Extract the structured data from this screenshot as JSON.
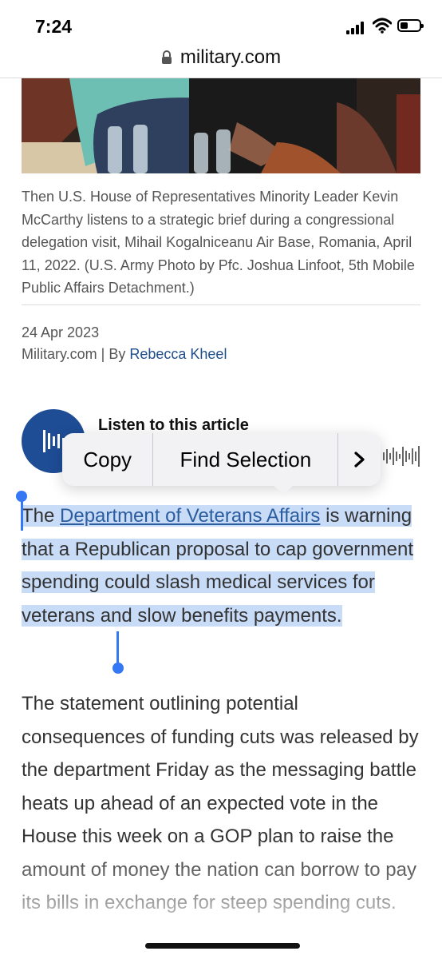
{
  "status": {
    "time": "7:24"
  },
  "browser": {
    "url": "military.com"
  },
  "article": {
    "caption": "Then U.S. House of Representatives Minority Leader Kevin McCarthy listens to a strategic brief during a congressional delegation visit, Mihail Kogalniceanu Air Base, Romania, April 11, 2022. (U.S. Army Photo by Pfc. Joshua Linfoot, 5th Mobile Public Affairs Detachment.)",
    "date": "24 Apr 2023",
    "source": "Military.com | By ",
    "author": "Rebecca Kheel",
    "listen_label": "Listen to this article",
    "para1": {
      "prefix": "The ",
      "link": "Department of Veterans Affairs",
      "rest": " is warning that a Republican proposal to cap government spending could slash medical services for veterans and slow benefits payments."
    },
    "para2": "The statement outlining potential consequences of funding cuts was released by the department Friday as the messaging battle heats up ahead of an expected vote in the House this week on a GOP plan to raise the amount of money the nation can borrow to pay its bills in exchange for steep spending cuts."
  },
  "menu": {
    "copy": "Copy",
    "find": "Find Selection",
    "more": "›"
  },
  "icons": {
    "lock": "lock-icon",
    "signal": "signal-icon",
    "wifi": "wifi-icon",
    "battery": "battery-icon",
    "audio": "audio-wave-icon",
    "more": "chevron-right-icon"
  },
  "colors": {
    "accent": "#3478f6",
    "selection": "#c8dbf7",
    "link": "#2b5d9e",
    "audio_button": "#1e4d96"
  }
}
